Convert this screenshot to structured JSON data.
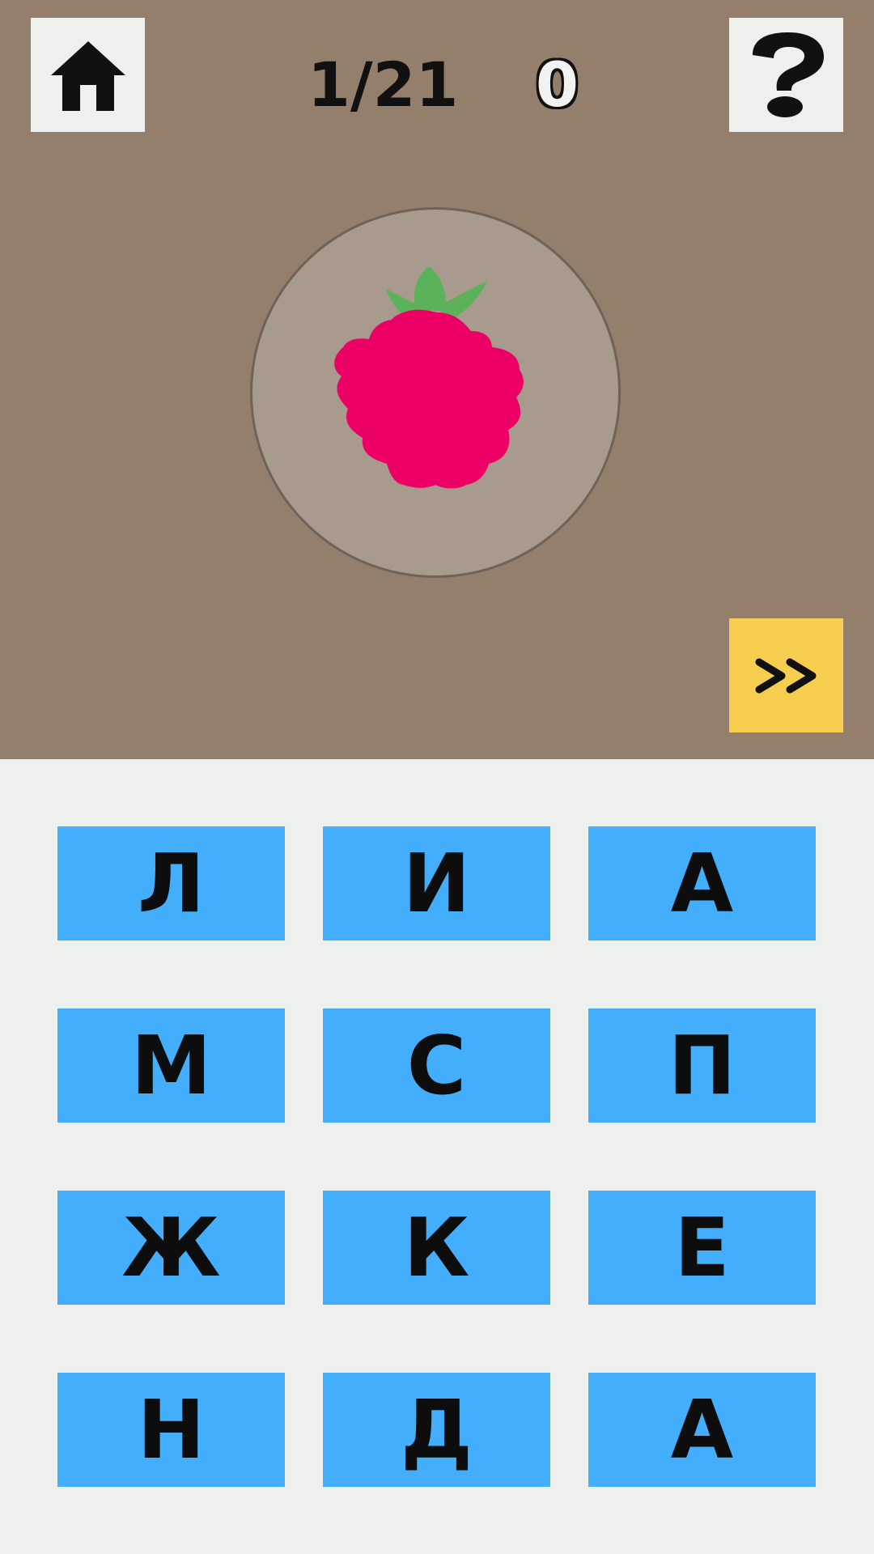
{
  "header": {
    "progress": "1/21",
    "score": "0",
    "home_icon": "home-icon",
    "help_icon": "question-mark-icon"
  },
  "picture": {
    "icon": "raspberry-icon",
    "colors": {
      "berry": "#ec0066",
      "leaves": "#5cb25a",
      "circle": "#a89a8d"
    }
  },
  "next_button": {
    "label": ">>",
    "color": "#f7cd50"
  },
  "letters": [
    "Л",
    "И",
    "А",
    "М",
    "С",
    "П",
    "Ж",
    "К",
    "Е",
    "Н",
    "Д",
    "А"
  ],
  "colors": {
    "top_background": "#937f6c",
    "bottom_background": "#eef0ee",
    "letter_tile": "#43aefb"
  }
}
